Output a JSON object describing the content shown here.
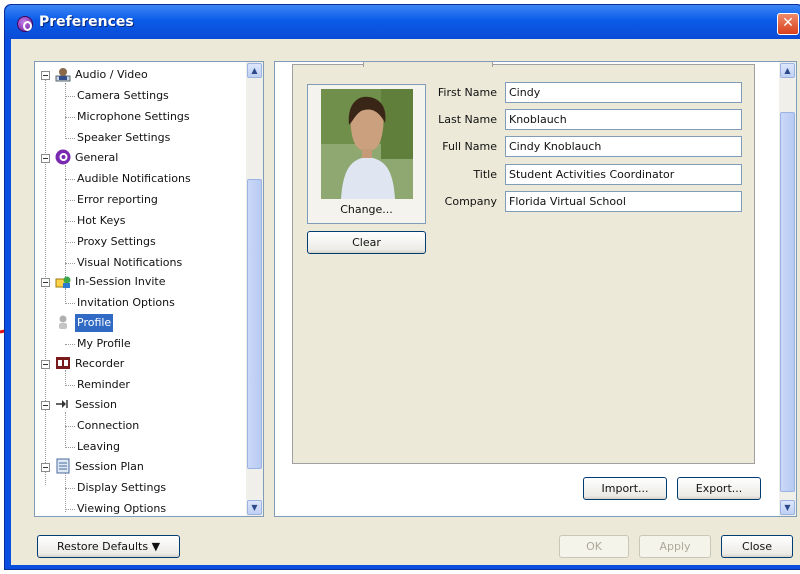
{
  "window": {
    "title": "Preferences",
    "close_glyph": "✕"
  },
  "tree": {
    "items": [
      {
        "label": "Audio / Video",
        "icon": "person-icon"
      },
      {
        "label": "Camera Settings"
      },
      {
        "label": "Microphone Settings"
      },
      {
        "label": "Speaker Settings"
      },
      {
        "label": "General",
        "icon": "purple-logo-icon"
      },
      {
        "label": "Audible Notifications"
      },
      {
        "label": "Error reporting"
      },
      {
        "label": "Hot Keys"
      },
      {
        "label": "Proxy Settings"
      },
      {
        "label": "Visual Notifications"
      },
      {
        "label": "In-Session Invite",
        "icon": "invite-icon"
      },
      {
        "label": "Invitation Options"
      },
      {
        "label": "Profile",
        "icon": "profile-icon"
      },
      {
        "label": "My Profile"
      },
      {
        "label": "Recorder",
        "icon": "recorder-icon"
      },
      {
        "label": "Reminder"
      },
      {
        "label": "Session",
        "icon": "session-icon"
      },
      {
        "label": "Connection"
      },
      {
        "label": "Leaving"
      },
      {
        "label": "Session Plan",
        "icon": "session-plan-icon"
      },
      {
        "label": "Display Settings"
      },
      {
        "label": "Viewing Options"
      }
    ]
  },
  "profile": {
    "change_label": "Change...",
    "clear_label": "Clear",
    "fields": [
      {
        "label": "First Name",
        "value": "Cindy"
      },
      {
        "label": "Last Name",
        "value": "Knoblauch"
      },
      {
        "label": "Full Name",
        "value": "Cindy Knoblauch"
      },
      {
        "label": "Title",
        "value": "Student Activities Coordinator"
      },
      {
        "label": "Company",
        "value": "Florida Virtual School"
      }
    ],
    "import_label": "Import...",
    "export_label": "Export..."
  },
  "footer": {
    "restore_label": "Restore Defaults ▼",
    "ok_label": "OK",
    "apply_label": "Apply",
    "close_label": "Close"
  },
  "colors": {
    "selection": "#316ac5",
    "titlebar": "#0b5be8",
    "arrow": "#e01010"
  }
}
